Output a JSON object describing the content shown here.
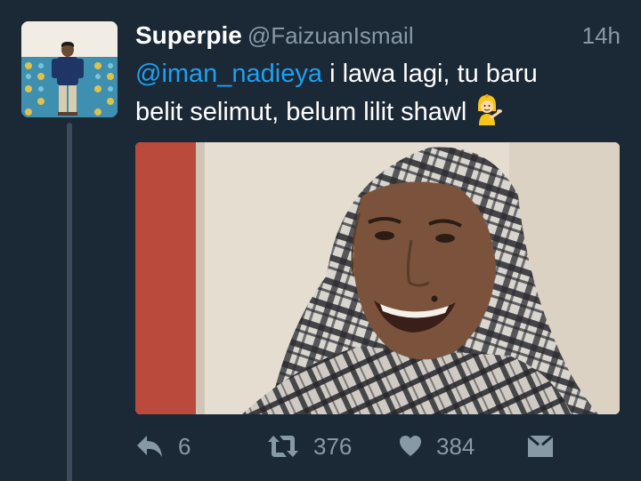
{
  "tweet": {
    "display_name": "Superpie",
    "handle": "@FaizuanIsmail",
    "timestamp": "14h",
    "mention": "@iman_nadieya",
    "text_line1": " i lawa lagi, tu baru",
    "text_line2": "belit selimut, belum lilit shawl",
    "emoji": "woman-tipping-hand-emoji"
  },
  "actions": {
    "reply_count": "6",
    "retweet_count": "376",
    "like_count": "384"
  },
  "colors": {
    "background": "#1b2836",
    "text": "#ffffff",
    "secondary": "#8899a6",
    "link": "#1da1f2",
    "thread_line": "#3c4b5b"
  },
  "icons": {
    "reply": "reply-icon",
    "retweet": "retweet-icon",
    "like": "heart-icon",
    "message": "direct-message-icon"
  }
}
